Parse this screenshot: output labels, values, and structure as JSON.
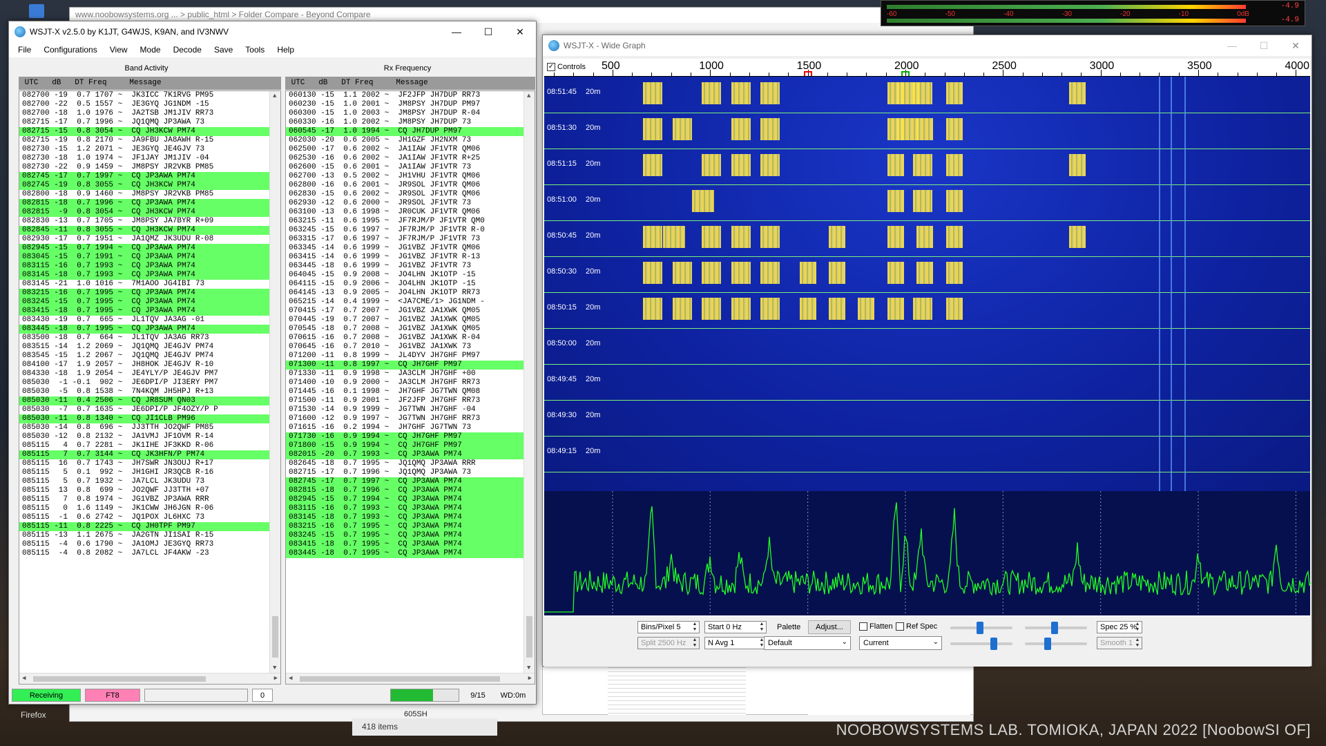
{
  "background": {
    "browser_tab_title": "www.noobowsystems.org ... > public_html > Folder Compare - Beyond Compare",
    "items_count": "418 items",
    "chip_label": "605SH",
    "firefox_label": "Firefox",
    "watermark": "NOOBOWSYSTEMS LAB. TOMIOKA, JAPAN 2022 [NoobowSI OF]"
  },
  "meter": {
    "ticks": [
      "-60",
      "-50",
      "-40",
      "-30",
      "-20",
      "-10",
      "0dB"
    ],
    "readout_top": "-4.9",
    "readout_bottom": "-4.9"
  },
  "main": {
    "title": "WSJT-X   v2.5.0   by K1JT, G4WJS, K9AN, and IV3NWV",
    "menu": [
      "File",
      "Configurations",
      "View",
      "Mode",
      "Decode",
      "Save",
      "Tools",
      "Help"
    ],
    "band_activity_title": "Band Activity",
    "rx_frequency_title": "Rx Frequency",
    "column_header": " UTC   dB   DT Freq     Message",
    "band_rows": [
      {
        "t": "082700 -19  0.7 1707 ~  JK3ICC 7K1RVG PM95",
        "cq": false
      },
      {
        "t": "082700 -22  0.5 1557 ~  JE3GYQ JG1NDM -15",
        "cq": false
      },
      {
        "t": "082700 -18  1.0 1976 ~  JA2TSB JM1JIV RR73",
        "cq": false
      },
      {
        "t": "082715 -17  0.7 1996 ~  JQ1QMQ JP3AWA 73",
        "cq": false
      },
      {
        "t": "082715 -15  0.8 3054 ~  CQ JH3KCW PM74",
        "cq": true
      },
      {
        "t": "082715 -19  0.8 2170 ~  JA9FBU JA8AWH R-15",
        "cq": false
      },
      {
        "t": "082730 -15  1.2 2071 ~  JE3GYQ JE4GJV 73",
        "cq": false
      },
      {
        "t": "082730 -18  1.0 1974 ~  JF1JAY JM1JIV -04",
        "cq": false
      },
      {
        "t": "082730 -22  0.9 1459 ~  JM8PSY JR2VKB PM85",
        "cq": false
      },
      {
        "t": "082745 -17  0.7 1997 ~  CQ JP3AWA PM74",
        "cq": true
      },
      {
        "t": "082745 -19  0.8 3055 ~  CQ JH3KCW PM74",
        "cq": true
      },
      {
        "t": "082800 -18  0.9 1460 ~  JM8PSY JR2VKB PM85",
        "cq": false
      },
      {
        "t": "082815 -18  0.7 1996 ~  CQ JP3AWA PM74",
        "cq": true
      },
      {
        "t": "082815  -9  0.8 3054 ~  CQ JH3KCW PM74",
        "cq": true
      },
      {
        "t": "082830 -13  0.7 1705 ~  JM8PSY JA7BYR R+09",
        "cq": false
      },
      {
        "t": "082845 -11  0.8 3055 ~  CQ JH3KCW PM74",
        "cq": true
      },
      {
        "t": "082930 -17  0.7 1951 ~  JA1QMZ JK3UDU R-08",
        "cq": false
      },
      {
        "t": "082945 -15  0.7 1994 ~  CQ JP3AWA PM74",
        "cq": true
      },
      {
        "t": "083045 -15  0.7 1991 ~  CQ JP3AWA PM74",
        "cq": true
      },
      {
        "t": "083115 -16  0.7 1993 ~  CQ JP3AWA PM74",
        "cq": true
      },
      {
        "t": "083145 -18  0.7 1993 ~  CQ JP3AWA PM74",
        "cq": true
      },
      {
        "t": "083145 -21  1.0 1016 ~  7M1AOO JG4IBI 73",
        "cq": false
      },
      {
        "t": "083215 -16  0.7 1995 ~  CQ JP3AWA PM74",
        "cq": true
      },
      {
        "t": "083245 -15  0.7 1995 ~  CQ JP3AWA PM74",
        "cq": true
      },
      {
        "t": "083415 -18  0.7 1995 ~  CQ JP3AWA PM74",
        "cq": true
      },
      {
        "t": "083430 -19  0.7  665 ~  JL1TQV JA3AG -01",
        "cq": false
      },
      {
        "t": "083445 -18  0.7 1995 ~  CQ JP3AWA PM74",
        "cq": true
      },
      {
        "t": "083500 -18  0.7  664 ~  JL1TQV JA3AG RR73",
        "cq": false
      },
      {
        "t": "083515 -14  1.2 2069 ~  JQ1QMQ JE4GJV PM74",
        "cq": false
      },
      {
        "t": "083545 -15  1.2 2067 ~  JQ1QMQ JE4GJV PM74",
        "cq": false
      },
      {
        "t": "084100 -17  1.9 2057 ~  JH8HOK JE4GJV R-10",
        "cq": false
      },
      {
        "t": "084330 -18  1.9 2054 ~  JE4YLY/P JE4GJV PM7",
        "cq": false
      },
      {
        "t": "085030  -1 -0.1  902 ~  JE6DPI/P JI3ERY PM7",
        "cq": false
      },
      {
        "t": "085030  -5  0.8 1538 ~  7N4KQM JH5HPJ R+13",
        "cq": false
      },
      {
        "t": "085030 -11  0.4 2506 ~  CQ JR8SUM QN03",
        "cq": true
      },
      {
        "t": "085030  -7  0.7 1635 ~  JE6DPI/P JF4OZY/P P",
        "cq": false
      },
      {
        "t": "085030 -11  0.8 1340 ~  CQ JI1CLB PM96",
        "cq": true
      },
      {
        "t": "085030 -14  0.8  696 ~  JJ3TTH JO2QWF PM85",
        "cq": false
      },
      {
        "t": "085030 -12  0.8 2132 ~  JA1VMJ JF1OVM R-14",
        "cq": false
      },
      {
        "t": "085115   4  0.7 2281 ~  JK1IHE JF3KKD R-06",
        "cq": false
      },
      {
        "t": "085115   7  0.7 3144 ~  CQ JK3HFN/P PM74",
        "cq": true
      },
      {
        "t": "085115  16  0.7 1743 ~  JH7SWR JN3OUJ R+17",
        "cq": false
      },
      {
        "t": "085115   5  0.1  992 ~  JH1GHI JR3QCB R-16",
        "cq": false
      },
      {
        "t": "085115   5  0.7 1932 ~  JA7LCL JK3UDU 73",
        "cq": false
      },
      {
        "t": "085115  13  0.8  699 ~  JO2QWF JJ3TTH +07",
        "cq": false
      },
      {
        "t": "085115   7  0.8 1974 ~  JG1VBZ JP3AWA RRR",
        "cq": false
      },
      {
        "t": "085115   0  1.6 1149 ~  JK1CWW JH6JGN R-06",
        "cq": false
      },
      {
        "t": "085115  -1  0.6 2742 ~  JQ1POX JL6HXC 73",
        "cq": false
      },
      {
        "t": "085115 -11  0.8 2225 ~  CQ JH0TPF PM97",
        "cq": true
      },
      {
        "t": "085115 -13  1.1 2675 ~  JA2GTN JI1SAI R-15",
        "cq": false
      },
      {
        "t": "085115  -4  0.6 1790 ~  JA1OMJ JE3GYQ RR73",
        "cq": false
      },
      {
        "t": "085115  -4  0.8 2082 ~  JA7LCL JF4AKW -23",
        "cq": false
      }
    ],
    "rx_rows": [
      {
        "t": "060130 -15  1.1 2002 ~  JF2JFP JH7DUP RR73",
        "cq": false
      },
      {
        "t": "060230 -15  1.0 2001 ~  JM8PSY JH7DUP PM97",
        "cq": false
      },
      {
        "t": "060300 -15  1.0 2003 ~  JM8PSY JH7DUP R-04",
        "cq": false
      },
      {
        "t": "060330 -16  1.0 2002 ~  JM8PSY JH7DUP 73",
        "cq": false
      },
      {
        "t": "060545 -17  1.0 1994 ~  CQ JH7DUP PM97",
        "cq": true
      },
      {
        "t": "062030 -20  0.6 2005 ~  JH1GZF JH2NXM 73",
        "cq": false
      },
      {
        "t": "062500 -17  0.6 2002 ~  JA1IAW JF1VTR QM06",
        "cq": false
      },
      {
        "t": "062530 -16  0.6 2002 ~  JA1IAW JF1VTR R+25",
        "cq": false
      },
      {
        "t": "062600 -15  0.6 2001 ~  JA1IAW JF1VTR 73",
        "cq": false
      },
      {
        "t": "062700 -13  0.5 2002 ~  JH1VHU JF1VTR QM06",
        "cq": false
      },
      {
        "t": "062800 -16  0.6 2001 ~  JR9SOL JF1VTR QM06",
        "cq": false
      },
      {
        "t": "062830 -15  0.6 2002 ~  JR9SOL JF1VTR QM06",
        "cq": false
      },
      {
        "t": "062930 -12  0.6 2000 ~  JR9SOL JF1VTR 73",
        "cq": false
      },
      {
        "t": "063100 -13  0.6 1998 ~  JR0CUK JF1VTR QM06",
        "cq": false
      },
      {
        "t": "063215 -11  0.6 1995 ~  JF7RJM/P JF1VTR QM0",
        "cq": false
      },
      {
        "t": "063245 -15  0.6 1997 ~  JF7RJM/P JF1VTR R-0",
        "cq": false
      },
      {
        "t": "063315 -17  0.6 1997 ~  JF7RJM/P JF1VTR 73",
        "cq": false
      },
      {
        "t": "063345 -14  0.6 1999 ~  JG1VBZ JF1VTR QM06",
        "cq": false
      },
      {
        "t": "063415 -14  0.6 1999 ~  JG1VBZ JF1VTR R-13",
        "cq": false
      },
      {
        "t": "063445 -18  0.6 1999 ~  JG1VBZ JF1VTR 73",
        "cq": false
      },
      {
        "t": "064045 -15  0.9 2008 ~  JO4LHN JK1OTP -15",
        "cq": false
      },
      {
        "t": "064115 -15  0.9 2006 ~  JO4LHN JK1OTP -15",
        "cq": false
      },
      {
        "t": "064145 -13  0.9 2005 ~  JO4LHN JK1OTP RR73",
        "cq": false
      },
      {
        "t": "065215 -14  0.4 1999 ~  <JA7CME/1> JG1NDM -",
        "cq": false
      },
      {
        "t": "070415 -17  0.7 2007 ~  JG1VBZ JA1XWK QM05",
        "cq": false
      },
      {
        "t": "070445 -19  0.7 2007 ~  JG1VBZ JA1XWK QM05",
        "cq": false
      },
      {
        "t": "070545 -18  0.7 2008 ~  JG1VBZ JA1XWK QM05",
        "cq": false
      },
      {
        "t": "070615 -16  0.7 2008 ~  JG1VBZ JA1XWK R-04",
        "cq": false
      },
      {
        "t": "070645 -16  0.7 2010 ~  JG1VBZ JA1XWK 73",
        "cq": false
      },
      {
        "t": "071200 -11  0.8 1999 ~  JL4DYV JH7GHF PM97",
        "cq": false
      },
      {
        "t": "071300 -11  0.8 1997 ~  CQ JH7GHF PM97",
        "cq": true
      },
      {
        "t": "071330 -11  0.9 1998 ~  JA3CLM JH7GHF +00",
        "cq": false
      },
      {
        "t": "071400 -10  0.9 2000 ~  JA3CLM JH7GHF RR73",
        "cq": false
      },
      {
        "t": "071445 -16  0.1 1998 ~  JH7GHF JG7TWN QM08",
        "cq": false
      },
      {
        "t": "071500 -11  0.9 2001 ~  JF2JFP JH7GHF RR73",
        "cq": false
      },
      {
        "t": "071530 -14  0.9 1999 ~  JG7TWN JH7GHF -04",
        "cq": false
      },
      {
        "t": "071600 -12  0.9 1997 ~  JG7TWN JH7GHF RR73",
        "cq": false
      },
      {
        "t": "071615 -16  0.2 1994 ~  JH7GHF JG7TWN 73",
        "cq": false
      },
      {
        "t": "071730 -16  0.9 1994 ~  CQ JH7GHF PM97",
        "cq": true
      },
      {
        "t": "071800 -15  0.9 1994 ~  CQ JH7GHF PM97",
        "cq": true
      },
      {
        "t": "082015 -20  0.7 1993 ~  CQ JP3AWA PM74",
        "cq": true
      },
      {
        "t": "082645 -18  0.7 1995 ~  JQ1QMQ JP3AWA RRR",
        "cq": false
      },
      {
        "t": "082715 -17  0.7 1996 ~  JQ1QMQ JP3AWA 73",
        "cq": false
      },
      {
        "t": "082745 -17  0.7 1997 ~  CQ JP3AWA PM74",
        "cq": true
      },
      {
        "t": "082815 -18  0.7 1996 ~  CQ JP3AWA PM74",
        "cq": true
      },
      {
        "t": "082945 -15  0.7 1994 ~  CQ JP3AWA PM74",
        "cq": true
      },
      {
        "t": "083115 -16  0.7 1993 ~  CQ JP3AWA PM74",
        "cq": true
      },
      {
        "t": "083145 -18  0.7 1993 ~  CQ JP3AWA PM74",
        "cq": true
      },
      {
        "t": "083215 -16  0.7 1995 ~  CQ JP3AWA PM74",
        "cq": true
      },
      {
        "t": "083245 -15  0.7 1995 ~  CQ JP3AWA PM74",
        "cq": true
      },
      {
        "t": "083415 -18  0.7 1995 ~  CQ JP3AWA PM74",
        "cq": true
      },
      {
        "t": "083445 -18  0.7 1995 ~  CQ JP3AWA PM74",
        "cq": true
      }
    ],
    "status": {
      "receiving": "Receiving",
      "mode": "FT8",
      "blank": "",
      "counter": "0",
      "progress": 0.62,
      "decoded": "9/15",
      "wd": "WD:0m"
    }
  },
  "widegraph": {
    "title": "WSJT-X - Wide Graph",
    "controls_label": "Controls",
    "scale_labels": [
      "500",
      "1000",
      "1500",
      "2000",
      "2500",
      "3000",
      "3500",
      "4000"
    ],
    "time_rows": [
      {
        "time": "08:51:45",
        "band": "20m"
      },
      {
        "time": "08:51:30",
        "band": "20m"
      },
      {
        "time": "08:51:15",
        "band": "20m"
      },
      {
        "time": "08:51:00",
        "band": "20m"
      },
      {
        "time": "08:50:45",
        "band": "20m"
      },
      {
        "time": "08:50:30",
        "band": "20m"
      },
      {
        "time": "08:50:15",
        "band": "20m"
      },
      {
        "time": "08:50:00",
        "band": "20m"
      },
      {
        "time": "08:49:45",
        "band": "20m"
      },
      {
        "time": "08:49:30",
        "band": "20m"
      },
      {
        "time": "08:49:15",
        "band": "20m"
      }
    ],
    "controls": {
      "bins_per_pixel": "Bins/Pixel  5",
      "start": "Start 0 Hz",
      "split": "Split  2500  Hz",
      "navg": "N Avg  1",
      "palette_label": "Palette",
      "adjust_label": "Adjust...",
      "palette_value": "Default",
      "flatten_label": "Flatten",
      "refspec_label": "Ref Spec",
      "mode_value": "Current",
      "spec_value": "Spec 25 %",
      "smooth_value": "Smooth  1"
    },
    "colors": {
      "waterfall": "#0e22a0",
      "signal": "#ffe34a",
      "spectrum": "#22ff22",
      "cq_row": "#66ff66"
    }
  }
}
